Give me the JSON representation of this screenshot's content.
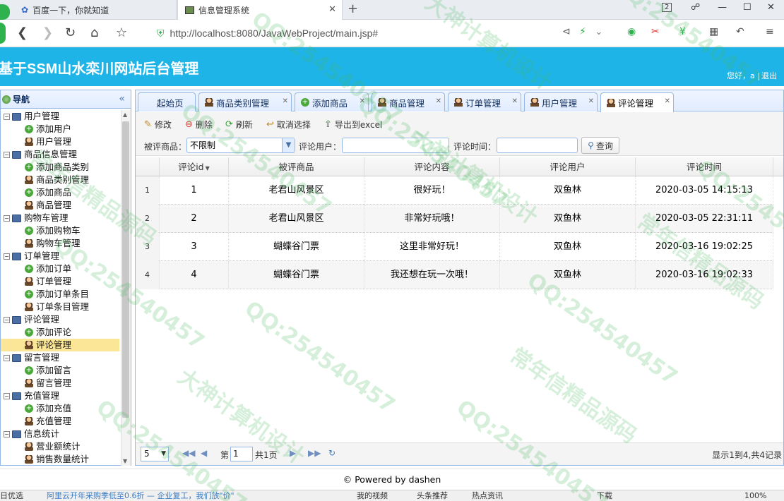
{
  "browser": {
    "tabs": [
      {
        "label": "百度一下，你就知道"
      },
      {
        "label": "信息管理系统"
      }
    ],
    "tab_badge": "2",
    "url": "http://localhost:8080/JavaWebProject/main.jsp#"
  },
  "header": {
    "title": "基于SSM山水栾川网站后台管理",
    "greeting": "您好，a |",
    "logout": "退出"
  },
  "nav": {
    "title": "导航",
    "groups": [
      {
        "label": "用户管理",
        "children": [
          "添加用户",
          "用户管理"
        ]
      },
      {
        "label": "商品信息管理",
        "children": [
          "添加商品类别",
          "商品类别管理",
          "添加商品",
          "商品管理"
        ]
      },
      {
        "label": "购物车管理",
        "children": [
          "添加购物车",
          "购物车管理"
        ]
      },
      {
        "label": "订单管理",
        "children": [
          "添加订单",
          "订单管理",
          "添加订单条目",
          "订单条目管理"
        ]
      },
      {
        "label": "评论管理",
        "children": [
          "添加评论",
          "评论管理"
        ]
      },
      {
        "label": "留言管理",
        "children": [
          "添加留言",
          "留言管理"
        ]
      },
      {
        "label": "充值管理",
        "children": [
          "添加充值",
          "充值管理"
        ]
      },
      {
        "label": "信息统计",
        "children": [
          "营业额统计",
          "销售数量统计"
        ]
      }
    ],
    "selected": "评论管理"
  },
  "tabs": [
    {
      "label": "起始页"
    },
    {
      "label": "商品类别管理"
    },
    {
      "label": "添加商品"
    },
    {
      "label": "商品管理"
    },
    {
      "label": "订单管理"
    },
    {
      "label": "用户管理"
    },
    {
      "label": "评论管理"
    }
  ],
  "toolbar": {
    "edit": "修改",
    "delete": "删除",
    "refresh": "刷新",
    "cancel_select": "取消选择",
    "export": "导出到excel"
  },
  "filters": {
    "product_label": "被评商品：",
    "product_value": "不限制",
    "user_label": "评论用户：",
    "user_value": "",
    "time_label": "评论时间：",
    "time_value": "",
    "query": "查询"
  },
  "grid": {
    "columns": [
      "评论id",
      "被评商品",
      "评论内容",
      "评论用户",
      "评论时间"
    ],
    "rows": [
      {
        "no": "1",
        "id": "1",
        "product": "老君山风景区",
        "content": "很好玩！",
        "user": "双鱼林",
        "time": "2020-03-05 14:15:13"
      },
      {
        "no": "2",
        "id": "2",
        "product": "老君山风景区",
        "content": "非常好玩哦！",
        "user": "双鱼林",
        "time": "2020-03-05 22:31:11"
      },
      {
        "no": "3",
        "id": "3",
        "product": "蝴蝶谷门票",
        "content": "这里非常好玩！",
        "user": "双鱼林",
        "time": "2020-03-16 19:02:25"
      },
      {
        "no": "4",
        "id": "4",
        "product": "蝴蝶谷门票",
        "content": "我还想在玩一次哦！",
        "user": "双鱼林",
        "time": "2020-03-16 19:02:33"
      }
    ]
  },
  "pager": {
    "page_size": "5",
    "page_prefix": "第",
    "page": "1",
    "page_suffix": "共1页",
    "summary": "显示1到4,共4记录"
  },
  "footer": {
    "text": "© Powered by dashen"
  },
  "statusbar": {
    "left": "日优选",
    "news": "阿里云开年采购季低至0.6折 — 企业复工，我们放\"价\"",
    "video": "我的视频",
    "headline": "头条推荐",
    "hot": "热点资讯",
    "download": "下载",
    "zoom": "100%"
  },
  "watermarks": [
    "QQ:254540457",
    "大神计算机设计",
    "常年信精品源码"
  ]
}
